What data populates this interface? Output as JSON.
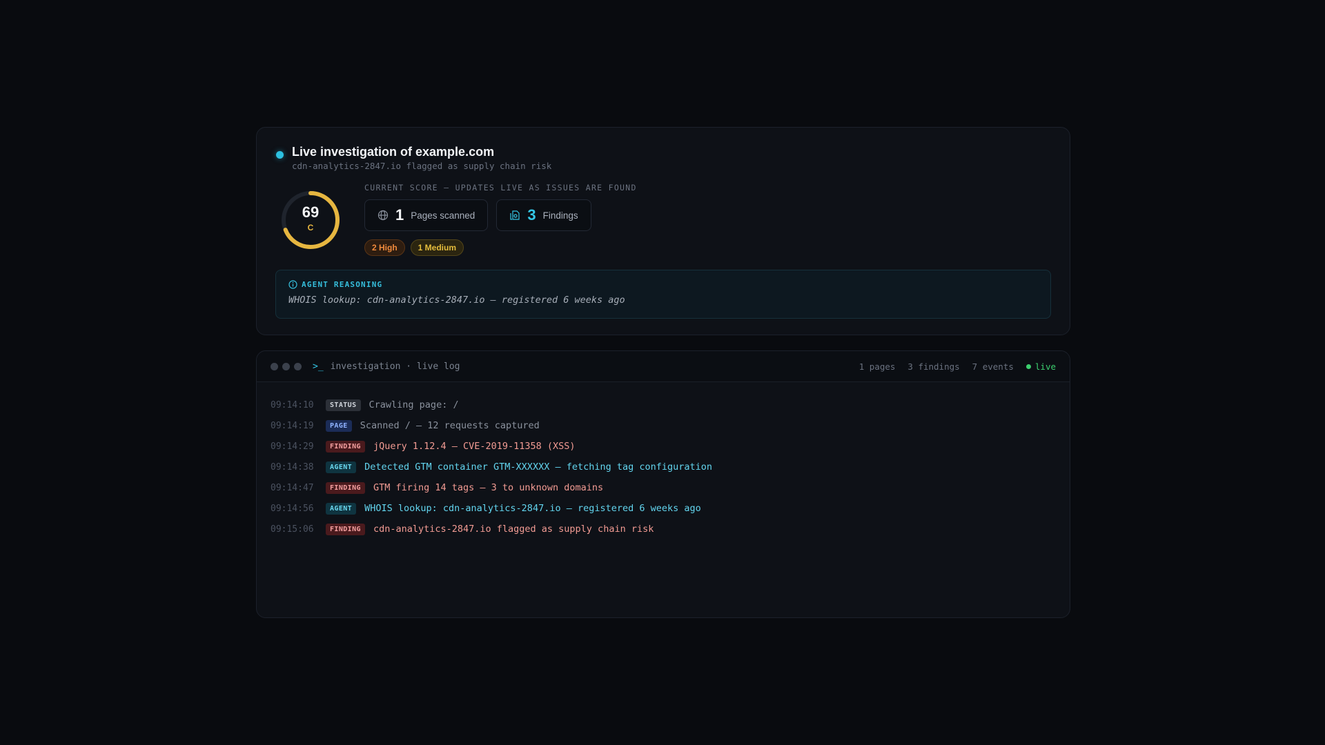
{
  "header": {
    "title": "Live investigation of example.com",
    "subtitle": "cdn-analytics-2847.io flagged as supply chain risk"
  },
  "score": {
    "value": "69",
    "fraction": 0.69,
    "grade": "C",
    "label": "CURRENT SCORE — UPDATES LIVE AS ISSUES ARE FOUND",
    "ring_color": "#e6b640",
    "track_color": "#1f242d"
  },
  "stats": {
    "pages": {
      "value": "1",
      "label": "Pages scanned",
      "icon": "globe-icon"
    },
    "findings": {
      "value": "3",
      "label": "Findings",
      "icon": "findings-icon"
    }
  },
  "badges": {
    "high": "2 High",
    "medium": "1 Medium"
  },
  "reasoning": {
    "heading": "AGENT REASONING",
    "text": "WHOIS lookup: cdn-analytics-2847.io — registered 6 weeks ago"
  },
  "terminal": {
    "title": "investigation · live log",
    "pages": "1 pages",
    "findings": "3 findings",
    "events": "7 events",
    "live": "live",
    "prompt": ">_"
  },
  "log": [
    {
      "time": "09:14:10",
      "tag": "STATUS",
      "kind": "status",
      "message": "Crawling page: /"
    },
    {
      "time": "09:14:19",
      "tag": "PAGE",
      "kind": "page",
      "message": "Scanned / — 12 requests captured"
    },
    {
      "time": "09:14:29",
      "tag": "FINDING",
      "kind": "finding",
      "message": "jQuery 1.12.4 — CVE-2019-11358 (XSS)"
    },
    {
      "time": "09:14:38",
      "tag": "AGENT",
      "kind": "agent",
      "message": "Detected GTM container GTM-XXXXXX — fetching tag configuration"
    },
    {
      "time": "09:14:47",
      "tag": "FINDING",
      "kind": "finding",
      "message": "GTM firing 14 tags — 3 to unknown domains"
    },
    {
      "time": "09:14:56",
      "tag": "AGENT",
      "kind": "agent",
      "message": "WHOIS lookup: cdn-analytics-2847.io — registered 6 weeks ago"
    },
    {
      "time": "09:15:06",
      "tag": "FINDING",
      "kind": "finding",
      "message": "cdn-analytics-2847.io flagged as supply chain risk"
    }
  ]
}
